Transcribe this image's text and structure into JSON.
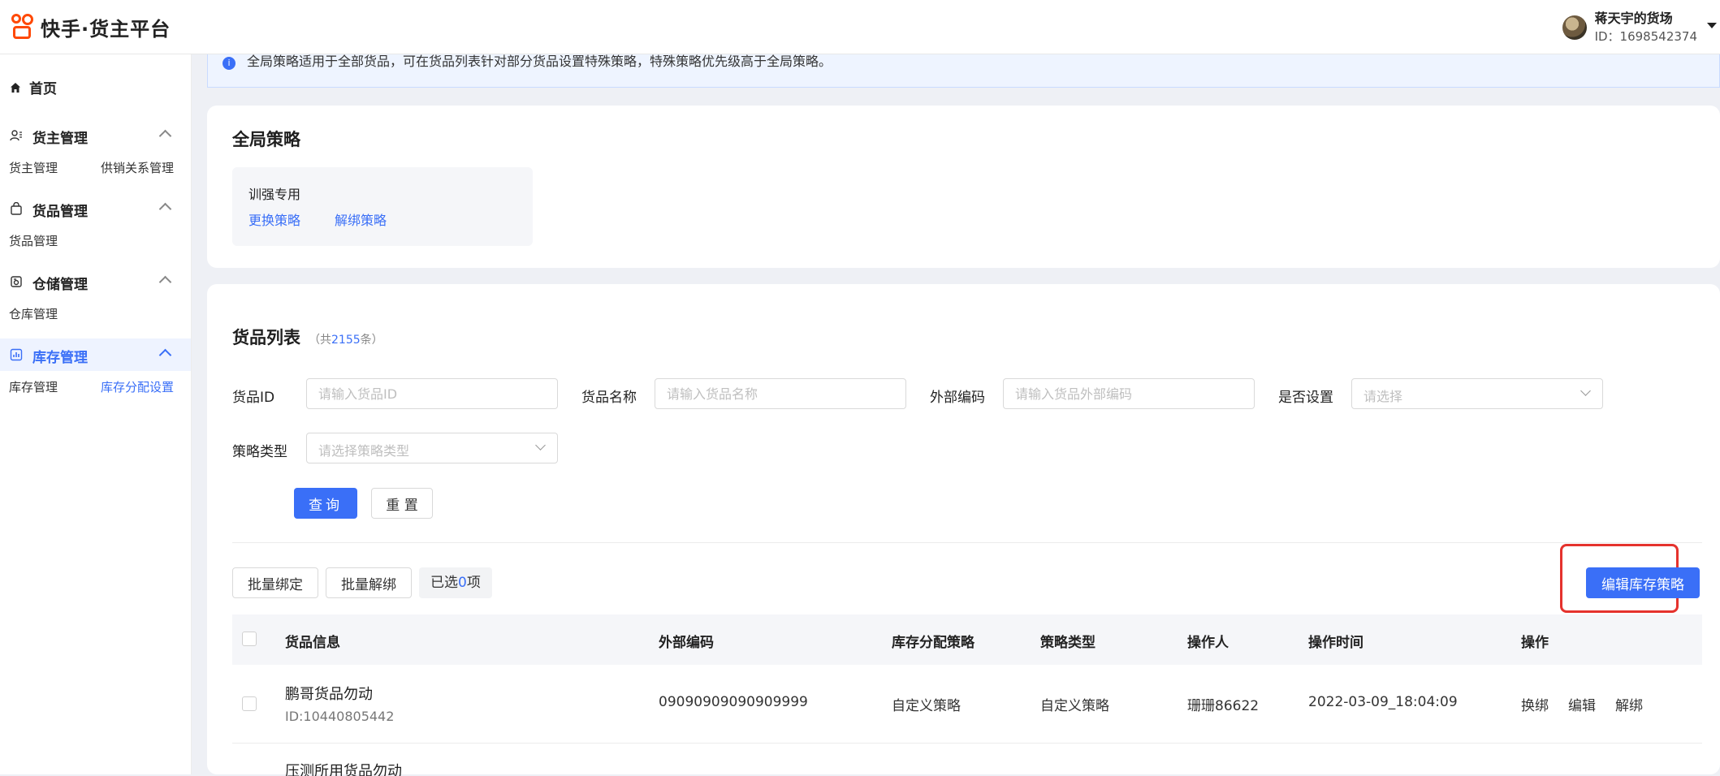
{
  "header": {
    "logo_text": "快手·货主平台",
    "user_name": "蒋天宇的货场",
    "user_id": "ID：1698542374"
  },
  "sidebar": {
    "home": "首页",
    "groups": [
      {
        "label": "货主管理",
        "icon": "user-group-icon",
        "subs": [
          "货主管理",
          "供销关系管理"
        ]
      },
      {
        "label": "货品管理",
        "icon": "bag-icon",
        "subs": [
          "货品管理"
        ]
      },
      {
        "label": "仓储管理",
        "icon": "warehouse-icon",
        "subs": [
          "仓库管理"
        ]
      },
      {
        "label": "库存管理",
        "icon": "chart-icon",
        "subs": [
          "库存管理",
          "库存分配设置"
        ]
      }
    ]
  },
  "banner": {
    "text": "全局策略适用于全部货品，可在货品列表针对部分货品设置特殊策略，特殊策略优先级高于全局策略。"
  },
  "global_strategy": {
    "title": "全局策略",
    "name": "训强专用",
    "change_link": "更换策略",
    "unbind_link": "解绑策略"
  },
  "product_list": {
    "title": "货品列表",
    "count_prefix": "（共",
    "count": "2155",
    "count_suffix": "条）",
    "filters": {
      "id_label": "货品ID",
      "id_placeholder": "请输入货品ID",
      "name_label": "货品名称",
      "name_placeholder": "请输入货品名称",
      "code_label": "外部编码",
      "code_placeholder": "请输入货品外部编码",
      "set_label": "是否设置",
      "set_placeholder": "请选择",
      "type_label": "策略类型",
      "type_placeholder": "请选择策略类型"
    },
    "query_button": "查询",
    "reset_button": "重 置",
    "batch_bind": "批量绑定",
    "batch_unbind": "批量解绑",
    "selected_prefix": "已选",
    "selected_count": "0",
    "selected_suffix": "项",
    "edit_strategy_button": "编辑库存策略",
    "columns": [
      "货品信息",
      "外部编码",
      "库存分配策略",
      "策略类型",
      "操作人",
      "操作时间",
      "操作"
    ],
    "rows": [
      {
        "name": "鹏哥货品勿动",
        "id": "ID:10440805442",
        "code": "09090909090909999",
        "strategy": "自定义策略",
        "type": "自定义策略",
        "operator": "珊珊86622",
        "time": "2022-03-09_18:04:09",
        "actions": [
          "换绑",
          "编辑",
          "解绑"
        ]
      },
      {
        "name": "压测所用货品勿动"
      }
    ]
  },
  "colors": {
    "primary": "#3a6ff7",
    "highlight": "#e5322d",
    "logo": "#ff4906"
  }
}
